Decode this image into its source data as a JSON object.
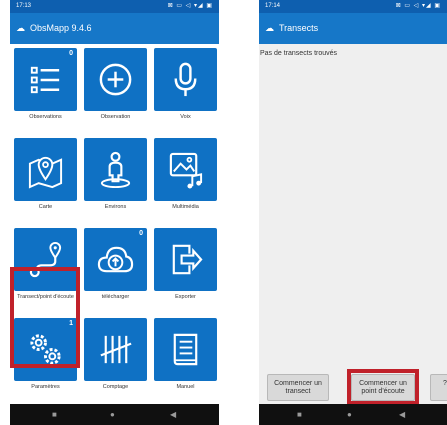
{
  "left": {
    "status": {
      "time": "17:13",
      "icons": "⊠ ▭ ◁ ▾◢ ▣"
    },
    "appbar": {
      "title": "ObsMapp 9.4.6"
    },
    "tiles": [
      {
        "label": "Observations",
        "icon": "list-icon",
        "badge": "0"
      },
      {
        "label": "Observation",
        "icon": "add-circle-icon",
        "badge": ""
      },
      {
        "label": "Voix",
        "icon": "microphone-icon",
        "badge": ""
      },
      {
        "label": "Carte",
        "icon": "map-marker-icon",
        "badge": ""
      },
      {
        "label": "Environs",
        "icon": "person-location-icon",
        "badge": ""
      },
      {
        "label": "Multimédia",
        "icon": "image-music-icon",
        "badge": ""
      },
      {
        "label": "Transect/point d'écoute",
        "icon": "route-icon",
        "badge": ""
      },
      {
        "label": "télécharger",
        "icon": "cloud-upload-icon",
        "badge": "0"
      },
      {
        "label": "Exporter",
        "icon": "export-icon",
        "badge": ""
      },
      {
        "label": "Paramètres",
        "icon": "gears-icon",
        "badge": "1"
      },
      {
        "label": "Comptage",
        "icon": "tally-icon",
        "badge": ""
      },
      {
        "label": "Manuel",
        "icon": "book-icon",
        "badge": ""
      }
    ]
  },
  "right": {
    "status": {
      "time": "17:14",
      "icons": "⊠ ▭ ◁ ▾◢ ▣"
    },
    "appbar": {
      "title": "Transects"
    },
    "message": "Pas de transects trouvés",
    "buttons": {
      "transect": "Commencer un transect",
      "point": "Commencer un point d'écoute",
      "third": "?"
    }
  },
  "colors": {
    "brand": "#1677c8",
    "tile": "#0f71c4",
    "highlight": "#c0212a"
  }
}
